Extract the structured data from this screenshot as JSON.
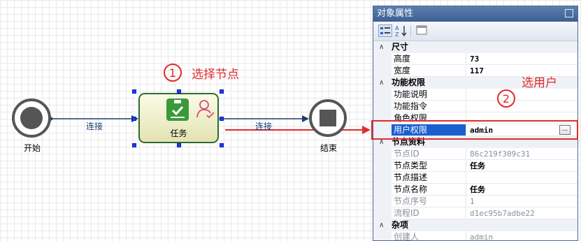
{
  "diagram": {
    "start_label": "开始",
    "task_label": "任务",
    "end_label": "结束",
    "flow1_label": "连接",
    "flow2_label": "连接"
  },
  "annotations": {
    "step1_num": "1",
    "step1_text": "选择节点",
    "step2_num": "2",
    "step2_text": "选用户"
  },
  "panel": {
    "title": "对象属性",
    "categories": [
      {
        "name": "尺寸",
        "rows": [
          {
            "name": "高度",
            "value": "73"
          },
          {
            "name": "宽度",
            "value": "117"
          }
        ]
      },
      {
        "name": "功能权限",
        "rows": [
          {
            "name": "功能说明",
            "value": ""
          },
          {
            "name": "功能指令",
            "value": ""
          },
          {
            "name": "角色权限",
            "value": ""
          },
          {
            "name": "用户权限",
            "value": "admin"
          }
        ]
      },
      {
        "name": "节点资料",
        "rows": [
          {
            "name": "节点ID",
            "value": "86c219f309c31"
          },
          {
            "name": "节点类型",
            "value": "任务"
          },
          {
            "name": "节点描述",
            "value": ""
          },
          {
            "name": "节点名称",
            "value": "任务"
          },
          {
            "name": "节点序号",
            "value": "1"
          },
          {
            "name": "流程ID",
            "value": "d1ec95b7adbe22"
          }
        ]
      },
      {
        "name": "杂项",
        "rows": [
          {
            "name": "创建人",
            "value": "admin"
          }
        ]
      }
    ],
    "ellipsis_label": "..."
  },
  "colors": {
    "annotation_red": "#e12b2b",
    "selection_blue": "#1a5fd0",
    "task_border": "#2e6b2f"
  }
}
